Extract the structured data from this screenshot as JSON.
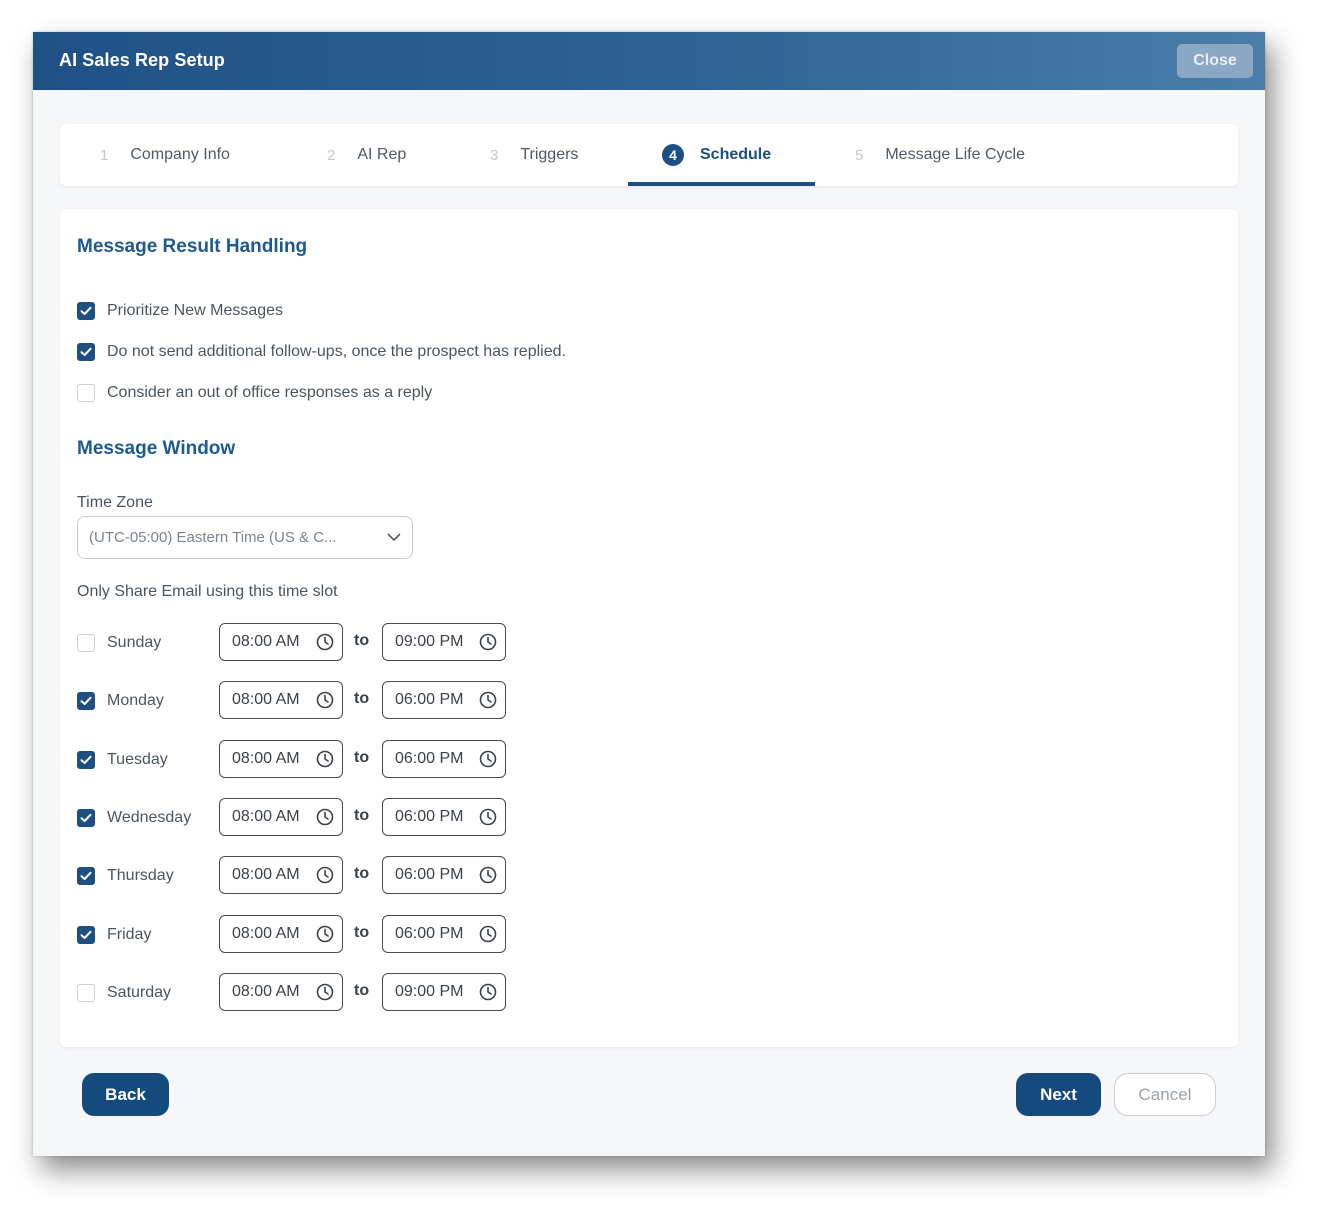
{
  "dialog": {
    "title": "AI Sales Rep Setup",
    "close_label": "Close"
  },
  "stepper": {
    "steps": [
      {
        "number": "1",
        "label": "Company Info"
      },
      {
        "number": "2",
        "label": "AI Rep"
      },
      {
        "number": "3",
        "label": "Triggers"
      },
      {
        "number": "4",
        "label": "Schedule"
      },
      {
        "number": "5",
        "label": "Message Life Cycle"
      }
    ],
    "active_step": "Schedule"
  },
  "result_handling": {
    "title": "Message Result Handling",
    "options": [
      {
        "label": "Prioritize New Messages",
        "checked": true
      },
      {
        "label": "Do not send additional follow-ups, once the prospect has replied.",
        "checked": true
      },
      {
        "label": "Consider an out of office responses as a reply",
        "checked": false
      }
    ]
  },
  "message_window": {
    "title": "Message Window",
    "timezone_label": "Time Zone",
    "timezone_value": "(UTC-05:00) Eastern Time (US & C...",
    "slot_label": "Only Share Email using this time slot",
    "to_label": "to",
    "days": [
      {
        "day": "Sunday",
        "checked": false,
        "from": "08:00 AM",
        "to": "09:00 PM"
      },
      {
        "day": "Monday",
        "checked": true,
        "from": "08:00 AM",
        "to": "06:00 PM"
      },
      {
        "day": "Tuesday",
        "checked": true,
        "from": "08:00 AM",
        "to": "06:00 PM"
      },
      {
        "day": "Wednesday",
        "checked": true,
        "from": "08:00 AM",
        "to": "06:00 PM"
      },
      {
        "day": "Thursday",
        "checked": true,
        "from": "08:00 AM",
        "to": "06:00 PM"
      },
      {
        "day": "Friday",
        "checked": true,
        "from": "08:00 AM",
        "to": "06:00 PM"
      },
      {
        "day": "Saturday",
        "checked": false,
        "from": "08:00 AM",
        "to": "09:00 PM"
      }
    ]
  },
  "footer": {
    "back_label": "Back",
    "next_label": "Next",
    "cancel_label": "Cancel"
  },
  "colors": {
    "primary": "#1d4f83",
    "header_start": "#1f5186",
    "header_end": "#4a7ea9",
    "section_title": "#1d5a8f"
  },
  "icons": {
    "checkbox_checked": "check-icon",
    "time": "clock-icon",
    "dropdown": "chevron-down-icon"
  }
}
